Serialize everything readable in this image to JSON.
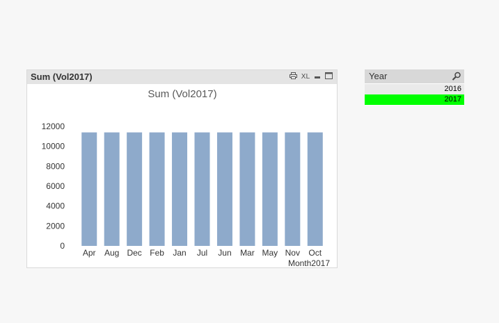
{
  "chart_object": {
    "caption": "Sum (Vol2017)",
    "icons": [
      "print-icon",
      "excel-icon",
      "minimize-icon",
      "maximize-icon"
    ],
    "icon_glyphs": {
      "excel": "XL"
    }
  },
  "chart_data": {
    "type": "bar",
    "title": "Sum (Vol2017)",
    "xlabel": "Month2017",
    "ylabel": "",
    "categories": [
      "Apr",
      "Aug",
      "Dec",
      "Feb",
      "Jan",
      "Jul",
      "Jun",
      "Mar",
      "May",
      "Nov",
      "Oct"
    ],
    "values": [
      11400,
      11400,
      11400,
      11400,
      11400,
      11400,
      11400,
      11400,
      11400,
      11400,
      11400
    ],
    "ylim": [
      0,
      12000
    ],
    "yticks": [
      0,
      2000,
      4000,
      6000,
      8000,
      10000,
      12000
    ],
    "bar_color": "#8eaacb",
    "grid": false,
    "legend": "none"
  },
  "listbox": {
    "title": "Year",
    "items": [
      {
        "label": "2016",
        "state": "optional"
      },
      {
        "label": "2017",
        "state": "selected"
      }
    ],
    "colors": {
      "selected": "#00ff00",
      "optional": "#eaeaea",
      "caption": "#d8d8d8"
    }
  }
}
